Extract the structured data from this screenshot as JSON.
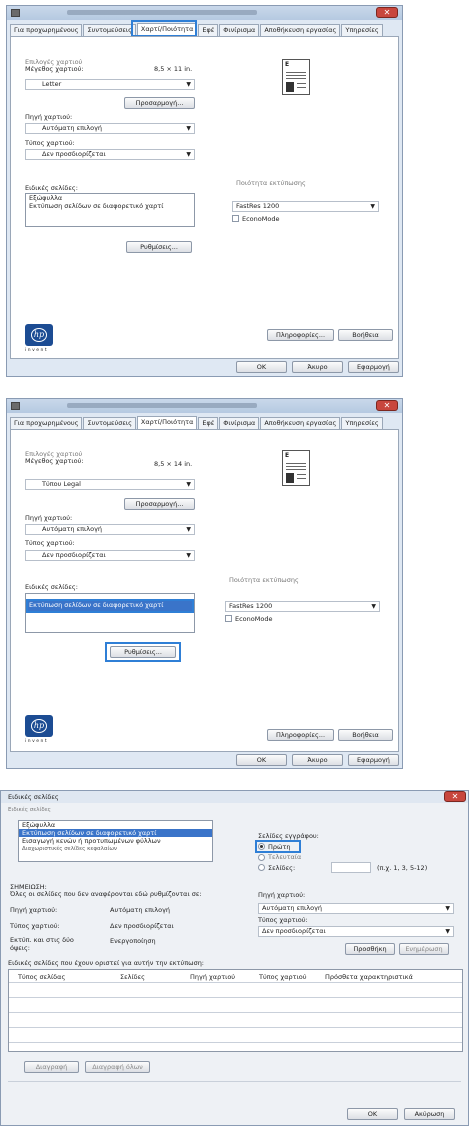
{
  "tabs": [
    "Για προχωρημένους",
    "Συντομεύσεις",
    "Χαρτί/Ποιότητα",
    "Εφέ",
    "Φινίρισμα",
    "Αποθήκευση εργασίας",
    "Υπηρεσίες"
  ],
  "window1": {
    "paper_options_group": "Επιλογές χαρτιού",
    "paper_size_label": "Μέγεθος χαρτιού:",
    "paper_size_dims": "8,5 × 11 in.",
    "paper_size_value": "Letter",
    "custom_button": "Προσαρμογή...",
    "paper_source_label": "Πηγή χαρτιού:",
    "paper_source_value": "Αυτόματη επιλογή",
    "paper_type_label": "Τύπος χαρτιού:",
    "paper_type_value": "Δεν προσδιορίζεται",
    "special_pages_label": "Ειδικές σελίδες:",
    "special_pages_items": [
      "Εξώφυλλα",
      "Εκτύπωση σελίδων σε διαφορετικό χαρτί"
    ],
    "settings_button": "Ρυθμίσεις...",
    "print_quality_group": "Ποιότητα εκτύπωσης",
    "print_quality_value": "FastRes 1200",
    "econo_mode": "EconoMode",
    "about_button": "Πληροφορίες...",
    "help_button": "Βοήθεια",
    "ok_button": "OK",
    "cancel_button": "Άκυρο",
    "apply_button": "Εφαρμογή",
    "logo_text": "invent"
  },
  "window2": {
    "paper_options_group": "Επιλογές χαρτιού",
    "paper_size_label": "Μέγεθος χαρτιού:",
    "paper_size_dims": "8,5 × 14 in.",
    "paper_size_value": "Τύπου Legal",
    "custom_button": "Προσαρμογή...",
    "paper_source_label": "Πηγή χαρτιού:",
    "paper_source_value": "Αυτόματη επιλογή",
    "paper_type_label": "Τύπος χαρτιού:",
    "paper_type_value": "Δεν προσδιορίζεται",
    "special_pages_label": "Ειδικές σελίδες:",
    "special_pages_selected": "Εκτύπωση σελίδων σε διαφορετικό χαρτί",
    "settings_button": "Ρυθμίσεις...",
    "print_quality_group": "Ποιότητα εκτύπωσης",
    "print_quality_value": "FastRes 1200",
    "econo_mode": "EconoMode",
    "about_button": "Πληροφορίες...",
    "help_button": "Βοήθεια",
    "ok_button": "OK",
    "cancel_button": "Άκυρο",
    "apply_button": "Εφαρμογή",
    "logo_text": "invent"
  },
  "dialog": {
    "title": "Ειδικές σελίδες",
    "group_label": "Ειδικές σελίδες",
    "list_items": [
      "Εξώφυλλα",
      "Εκτύπωση σελίδων σε διαφορετικό χαρτί",
      "Εισαγωγή κενών ή προτυπωμένων φύλλων",
      "Διαχωριστικές σελίδες κεφαλαίων"
    ],
    "print_pages_label": "Σελίδες εγγράφου:",
    "radio_first": "Πρώτη",
    "radio_last": "Τελευταία",
    "radio_pages": "Σελίδες:",
    "pages_hint": "(π.χ. 1, 3, 5-12)",
    "note_title": "ΣΗΜΕΙΩΣΗ:",
    "note_text": "Όλες οι σελίδες που δεν αναφέρονται εδώ ρυθμίζονται σε:",
    "paper_source_label": "Πηγή χαρτιού:",
    "paper_source_value": "Αυτόματη επιλογή",
    "paper_type_label": "Τύπος χαρτιού:",
    "paper_type_value": "Δεν προσδιορίζεται",
    "duplex_label": "Εκτύπ. και στις δύο όψεις:",
    "duplex_value": "Ενεργοποίηση",
    "right_source_label": "Πηγή χαρτιού:",
    "right_source_value": "Αυτόματη επιλογή",
    "right_type_label": "Τύπος χαρτιού:",
    "right_type_value": "Δεν προσδιορίζεται",
    "add_button": "Προσθήκη",
    "update_button": "Ενημέρωση",
    "table_caption": "Ειδικές σελίδες που έχουν οριστεί για αυτήν την εκτύπωση:",
    "table_headers": [
      "Τύπος σελίδας",
      "Σελίδες",
      "Πηγή χαρτιού",
      "Τύπος χαρτιού",
      "Πρόσθετα χαρακτηριστικά"
    ],
    "delete_button": "Διαγραφή",
    "delete_all_button": "Διαγραφή όλων",
    "ok_button": "OK",
    "cancel_button": "Ακύρωση"
  }
}
